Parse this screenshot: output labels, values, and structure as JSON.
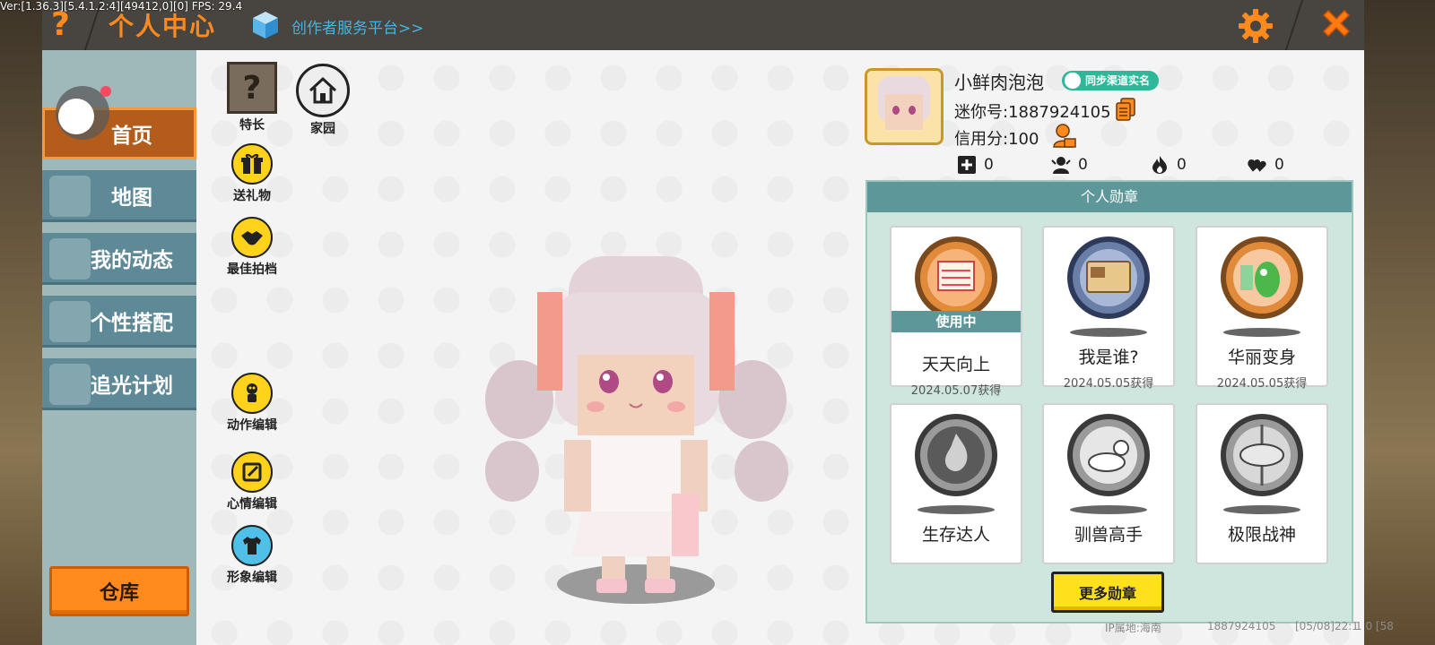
{
  "overlay": {
    "version": "Ver:[1.36.3][5.4.1.2:4][49412,0][0] FPS: 29.4"
  },
  "header": {
    "title": "个人中心",
    "creator_link": "创作者服务平台>>"
  },
  "sidebar": {
    "items": [
      {
        "label": "首页",
        "active": true
      },
      {
        "label": "地图",
        "active": false
      },
      {
        "label": "我的动态",
        "active": false
      },
      {
        "label": "个性搭配",
        "active": false
      },
      {
        "label": "追光计划",
        "active": false
      }
    ],
    "warehouse_label": "仓库"
  },
  "actions": {
    "specialty": "特长",
    "home": "家园",
    "gift": "送礼物",
    "partner": "最佳拍档",
    "motion_edit": "动作编辑",
    "mood_edit": "心情编辑",
    "look_edit": "形象编辑"
  },
  "profile": {
    "nickname": "小鲜肉泡泡",
    "verify_badge": "同步渠道实名",
    "mini_id": "迷你号:1887924105",
    "credit": "信用分:100",
    "stats": {
      "plus": "0",
      "fans": "0",
      "fire": "0",
      "likes": "0"
    }
  },
  "badges": {
    "header": "个人勋章",
    "in_use_label": "使用中",
    "more_label": "更多勋章",
    "items": [
      {
        "name": "天天向上",
        "date": "2024.05.07获得"
      },
      {
        "name": "我是谁?",
        "date": "2024.05.05获得"
      },
      {
        "name": "华丽变身",
        "date": "2024.05.05获得"
      },
      {
        "name": "生存达人",
        "date": ""
      },
      {
        "name": "驯兽高手",
        "date": ""
      },
      {
        "name": "极限战神",
        "date": ""
      }
    ]
  },
  "footer": {
    "ip": "IP属地:海南",
    "uid": "1887924105",
    "time": "[05/08]22:1",
    "extra": "1 0 [58"
  },
  "colors": {
    "accent": "#ff8a1d",
    "teal": "#5e979a",
    "sidebar": "#5e8996"
  }
}
